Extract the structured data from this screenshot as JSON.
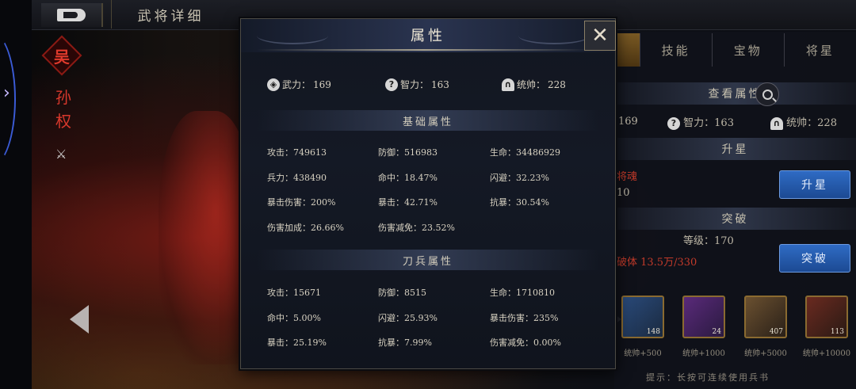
{
  "header": {
    "page_title": "武将详细"
  },
  "hero": {
    "faction": "吴",
    "name": "孙权"
  },
  "right_panel": {
    "tabs": [
      "",
      "技能",
      "宝物",
      "将星"
    ],
    "view_attr_label": "查看属性",
    "stats": {
      "force_value": "169",
      "intellect_label": "智力：",
      "intellect_value": "163",
      "command_label": "统帅：",
      "command_value": "228"
    },
    "star_up_header": "升星",
    "star_up_warning": "将魂",
    "star_up_value": "10",
    "star_up_button": "升星",
    "breakthrough_header": "突破",
    "level_text": "等级：170",
    "breakthrough_req": "破体 13.5万/330",
    "breakthrough_button": "突破",
    "items": [
      {
        "count": "148",
        "label": "统帅+500"
      },
      {
        "count": "24",
        "label": "统帅+1000"
      },
      {
        "count": "407",
        "label": "统帅+5000"
      },
      {
        "count": "113",
        "label": "统帅+10000"
      }
    ],
    "tip": "提示：长按可连续使用兵书"
  },
  "dialog": {
    "title": "属性",
    "primary_stats": [
      {
        "label": "武力：",
        "value": "169",
        "icon": "force-icon"
      },
      {
        "label": "智力：",
        "value": "163",
        "icon": "intellect-icon"
      },
      {
        "label": "统帅：",
        "value": "228",
        "icon": "command-icon"
      }
    ],
    "basic_section_title": "基础属性",
    "basic": [
      {
        "label": "攻击：",
        "value": "749613"
      },
      {
        "label": "防御：",
        "value": "516983"
      },
      {
        "label": "生命：",
        "value": "34486929"
      },
      {
        "label": "兵力：",
        "value": "438490"
      },
      {
        "label": "命中：",
        "value": "18.47%"
      },
      {
        "label": "闪避：",
        "value": "32.23%"
      },
      {
        "label": "暴击伤害：",
        "value": "200%"
      },
      {
        "label": "暴击：",
        "value": "42.71%"
      },
      {
        "label": "抗暴：",
        "value": "30.54%"
      },
      {
        "label": "伤害加成：",
        "value": "26.66%"
      },
      {
        "label": "伤害减免：",
        "value": "23.52%"
      }
    ],
    "troop_section_title": "刀兵属性",
    "troop": [
      {
        "label": "攻击：",
        "value": "15671"
      },
      {
        "label": "防御：",
        "value": "8515"
      },
      {
        "label": "生命：",
        "value": "1710810"
      },
      {
        "label": "命中：",
        "value": "5.00%"
      },
      {
        "label": "闪避：",
        "value": "25.93%"
      },
      {
        "label": "暴击伤害：",
        "value": "235%"
      },
      {
        "label": "暴击：",
        "value": "25.19%"
      },
      {
        "label": "抗暴：",
        "value": "7.99%"
      },
      {
        "label": "伤害减免：",
        "value": "0.00%"
      }
    ]
  }
}
